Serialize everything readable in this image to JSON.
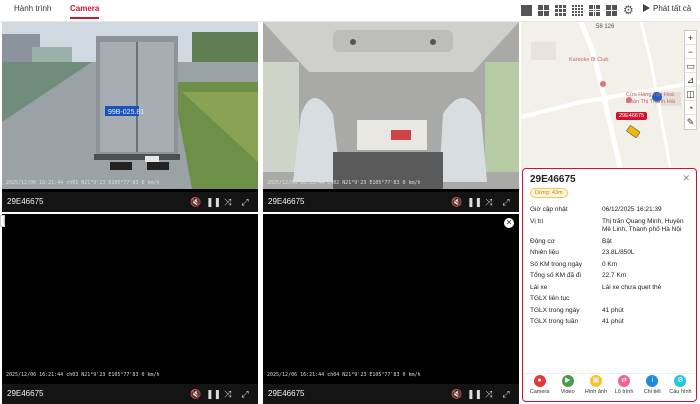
{
  "tabs": [
    {
      "label": "Hành trình",
      "active": false
    },
    {
      "label": "Camera",
      "active": true
    }
  ],
  "toolbar": {
    "layout_options": [
      "layout-1x1-icon",
      "layout-2x2-icon",
      "layout-3x3-icon",
      "layout-4x4-icon",
      "layout-5x5-icon"
    ],
    "settings_icon": "gear-icon",
    "play_all_label": "Phát tất cả"
  },
  "cameras": [
    {
      "plate": "29E46675",
      "overlay": "2025/12/06 16:21:44   ch01   N21°9'23   E105°77'83   0 km/h"
    },
    {
      "plate": "29E46675",
      "overlay": "2025/12/06 16:21:44   ch02   N21°9'23   E105°77'83   0 km/h"
    },
    {
      "plate": "29E46675",
      "overlay": "2025/12/06 16:21:44   ch03   N21°9'23   E105°77'83   0 km/h"
    },
    {
      "plate": "29E46675",
      "overlay": "2025/12/06 16:21:44   ch04   N21°9'23   E105°77'83   0 km/h"
    }
  ],
  "map": {
    "road_label": "58 126",
    "poi1": "Karaoke 8t Club",
    "poi2": [
      "Cửa Hàng Tạp Hoá",
      "Đoàn Thị Thanh Hải"
    ],
    "vehicle_tag": "29E46675"
  },
  "panel": {
    "title": "29E46675",
    "status": "Dừng: 43m",
    "rows": [
      {
        "label": "Giờ cập nhật",
        "value": "06/12/2025 16:21:39"
      },
      {
        "label": "Vị trí",
        "value": "Thị trấn Quang Minh, Huyện Mê Linh, Thành phố Hà Nội"
      },
      {
        "label": "Động cơ",
        "value": "Bật"
      },
      {
        "label": "Nhiên liệu",
        "value": "23.8L/850L"
      },
      {
        "label": "Số KM trong ngày",
        "value": "0 Km"
      },
      {
        "label": "Tổng số KM đã đi",
        "value": "22.7 Km"
      },
      {
        "label": "Lái xe",
        "value": "Lái xe chưa quẹt thẻ"
      },
      {
        "label": "TGLX liên tục",
        "value": ""
      },
      {
        "label": "TGLX trong ngày",
        "value": "41 phút"
      },
      {
        "label": "TGLX trong tuần",
        "value": "41 phút"
      }
    ],
    "actions": [
      {
        "label": "Camera",
        "color": "#e53935"
      },
      {
        "label": "Video",
        "color": "#43a047"
      },
      {
        "label": "Hình ảnh",
        "color": "#fbc02d"
      },
      {
        "label": "Lộ trình",
        "color": "#f06292"
      },
      {
        "label": "Chi tiết",
        "color": "#1e88e5"
      },
      {
        "label": "Cấu hình",
        "color": "#26c6da"
      }
    ]
  },
  "colors": {
    "accent": "#d0122f"
  }
}
